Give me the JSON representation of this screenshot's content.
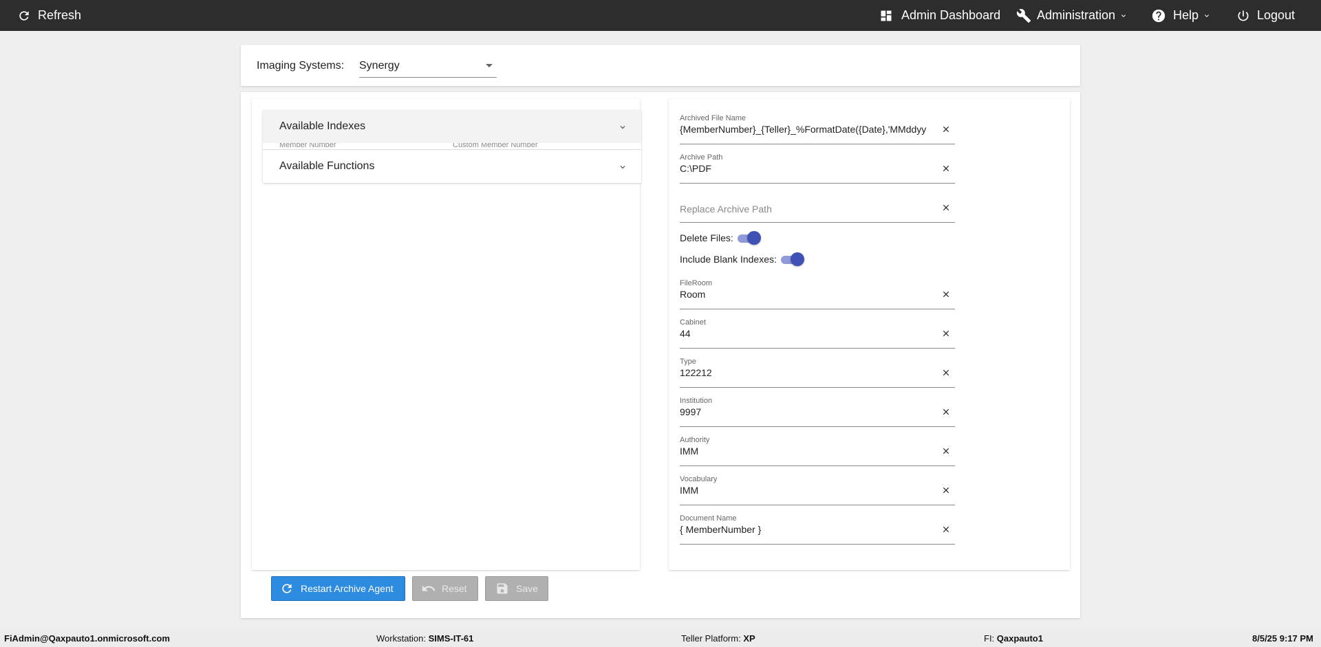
{
  "topbar": {
    "refresh_label": "Refresh",
    "admin_dashboard_label": "Admin Dashboard",
    "administration_label": "Administration",
    "help_label": "Help",
    "logout_label": "Logout"
  },
  "imaging": {
    "label": "Imaging Systems:",
    "selected": "Synergy"
  },
  "left": {
    "accordion": [
      {
        "label": "Available Indexes",
        "peek_left": "Member Number",
        "peek_right": "Custom Member Number"
      },
      {
        "label": "Available Functions"
      }
    ]
  },
  "right": {
    "fields": {
      "archived_file_name": {
        "label": "Archived File Name",
        "value": "{MemberNumber}_{Teller}_%FormatDate({Date},'MMddyy"
      },
      "archive_path": {
        "label": "Archive Path",
        "value": "C:\\PDF"
      },
      "replace_archive_path": {
        "placeholder": "Replace Archive Path"
      },
      "fileroom": {
        "label": "FileRoom",
        "value": "Room"
      },
      "cabinet": {
        "label": "Cabinet",
        "value": "44"
      },
      "type": {
        "label": "Type",
        "value": "122212"
      },
      "institution": {
        "label": "Institution",
        "value": "9997"
      },
      "authority": {
        "label": "Authority",
        "value": "IMM"
      },
      "vocabulary": {
        "label": "Vocabulary",
        "value": "IMM"
      },
      "document_name": {
        "label": "Document Name",
        "value": "{ MemberNumber }"
      }
    },
    "toggles": {
      "delete_files": {
        "label": "Delete Files:",
        "on": true
      },
      "include_blank_indexes": {
        "label": "Include Blank Indexes:",
        "on": true
      }
    }
  },
  "buttons": {
    "restart": "Restart Archive Agent",
    "reset": "Reset",
    "save": "Save"
  },
  "footer": {
    "user": "FiAdmin@Qaxpauto1.onmicrosoft.com",
    "workstation_label": "Workstation:",
    "workstation_value": "SIMS-IT-61",
    "platform_label": "Teller Platform:",
    "platform_value": "XP",
    "fi_label": "FI:",
    "fi_value": "Qaxpauto1",
    "datetime": "8/5/25 9:17 PM"
  },
  "colors": {
    "topbar": "#2d2d2d",
    "primary_button": "#2d8be0",
    "toggle": "#3f51b5",
    "disabled_button": "#b0b0b0"
  }
}
